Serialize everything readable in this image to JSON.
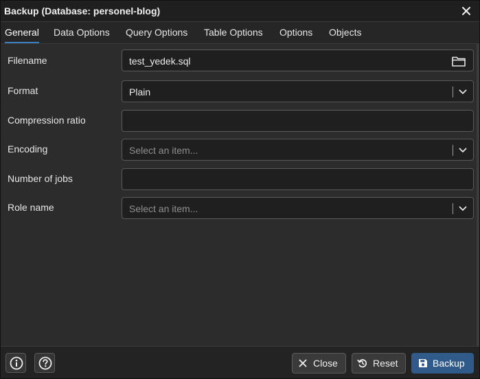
{
  "window": {
    "title": "Backup (Database: personel-blog)"
  },
  "tabs": [
    {
      "label": "General",
      "active": true
    },
    {
      "label": "Data Options",
      "active": false
    },
    {
      "label": "Query Options",
      "active": false
    },
    {
      "label": "Table Options",
      "active": false
    },
    {
      "label": "Options",
      "active": false
    },
    {
      "label": "Objects",
      "active": false
    }
  ],
  "form": {
    "filename": {
      "label": "Filename",
      "value": "test_yedek.sql",
      "icon": "folder-icon"
    },
    "format": {
      "label": "Format",
      "value": "Plain"
    },
    "compression_ratio": {
      "label": "Compression ratio",
      "value": ""
    },
    "encoding": {
      "label": "Encoding",
      "placeholder": "Select an item..."
    },
    "number_of_jobs": {
      "label": "Number of jobs",
      "value": ""
    },
    "role_name": {
      "label": "Role name",
      "placeholder": "Select an item..."
    }
  },
  "footer": {
    "info_icon": "info-icon",
    "help_icon": "help-icon",
    "close_label": "Close",
    "reset_label": "Reset",
    "backup_label": "Backup"
  },
  "colors": {
    "accent": "#3b82c4",
    "primary_button": "#2f5a8a",
    "background": "#2c2c2c",
    "input_background": "#1f1f1f"
  }
}
